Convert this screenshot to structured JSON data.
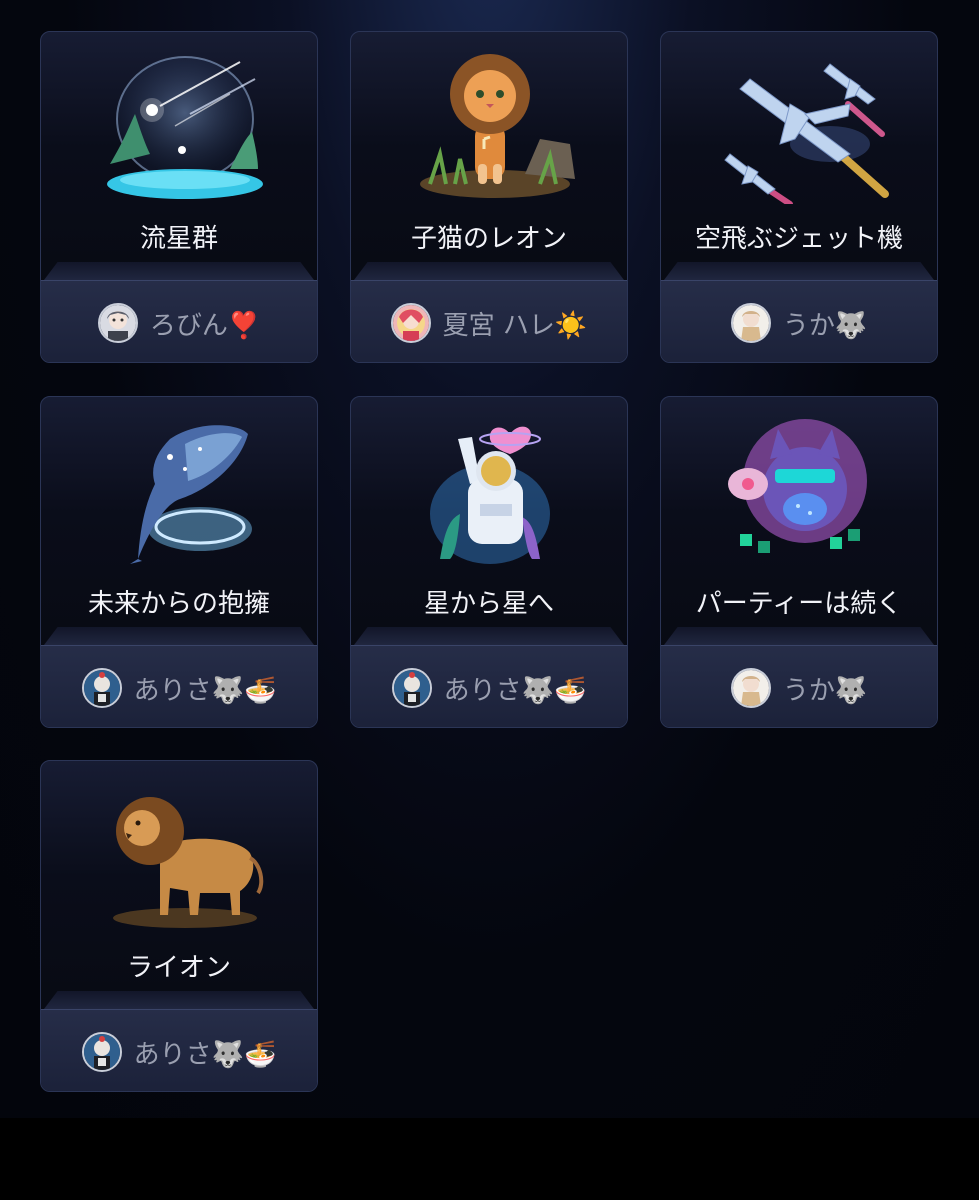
{
  "gifts": [
    {
      "name": "流星群",
      "art_icon": "meteor-shower-icon",
      "sender": {
        "name": "ろびん❣️",
        "avatar_icon": "avatar-robin"
      }
    },
    {
      "name": "子猫のレオン",
      "art_icon": "kitten-leon-icon",
      "sender": {
        "name": "夏宮 ハレ☀️",
        "avatar_icon": "avatar-natsumiya-hare"
      }
    },
    {
      "name": "空飛ぶジェット機",
      "art_icon": "flying-jets-icon",
      "sender": {
        "name": "うか🐺",
        "avatar_icon": "avatar-uka"
      }
    },
    {
      "name": "未来からの抱擁",
      "art_icon": "whale-hug-icon",
      "sender": {
        "name": "ありさ🐺🍜",
        "avatar_icon": "avatar-arisa"
      }
    },
    {
      "name": "星から星へ",
      "art_icon": "astronaut-icon",
      "sender": {
        "name": "ありさ🐺🍜",
        "avatar_icon": "avatar-arisa"
      }
    },
    {
      "name": "パーティーは続く",
      "art_icon": "party-cat-icon",
      "sender": {
        "name": "うか🐺",
        "avatar_icon": "avatar-uka"
      }
    },
    {
      "name": "ライオン",
      "art_icon": "lion-icon",
      "sender": {
        "name": "ありさ🐺🍜",
        "avatar_icon": "avatar-arisa"
      }
    }
  ],
  "colors": {
    "background": "#04060e",
    "card_border": "#2b3556",
    "sender_panel": "#232a44",
    "gift_name_text": "#f2f3f8",
    "sender_text": "#9a9fb0"
  }
}
